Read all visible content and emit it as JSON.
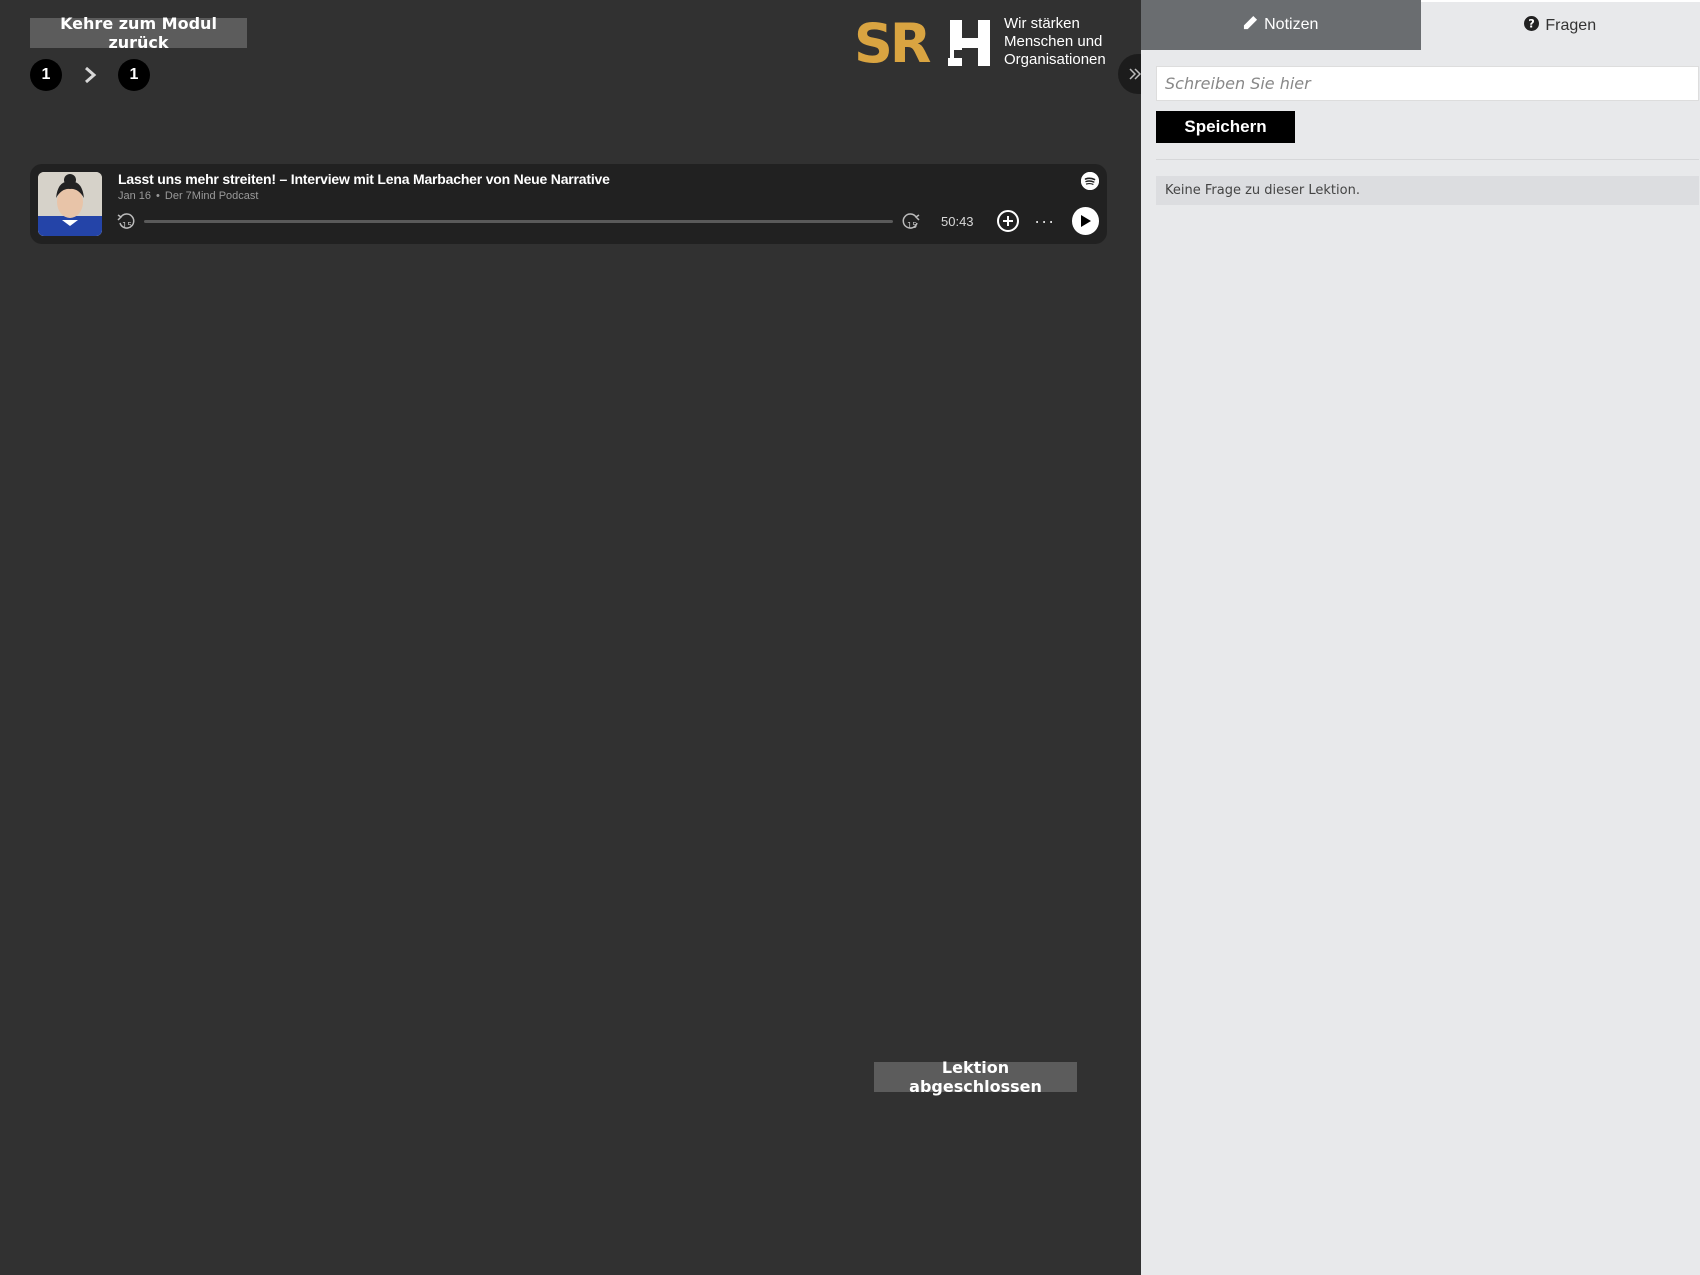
{
  "main": {
    "back_button_label": "Kehre zum Modul zurück",
    "breadcrumb": [
      "1",
      "1"
    ],
    "complete_button_label": "Lektion abgeschlossen"
  },
  "logo": {
    "brand_text": "SRH",
    "tagline_lines": [
      "Wir stärken",
      "Menschen und",
      "Organisationen"
    ],
    "brand_color": "#d9a441"
  },
  "player": {
    "title": "Lasst uns mehr streiten! – Interview mit Lena Marbacher von Neue Narrative",
    "date": "Jan 16",
    "podcast": "Der 7Mind Podcast",
    "duration": "50:43",
    "progress": 0,
    "skip_back_label": "15",
    "skip_forward_label": "15"
  },
  "sidebar": {
    "tabs": [
      {
        "label": "Notizen",
        "icon": "pencil-icon",
        "active": false
      },
      {
        "label": "Fragen",
        "icon": "question-circle-icon",
        "active": true
      }
    ],
    "input_placeholder": "Schreiben Sie hier",
    "input_value": "",
    "save_label": "Speichern",
    "empty_message": "Keine Frage zu dieser Lektion."
  }
}
